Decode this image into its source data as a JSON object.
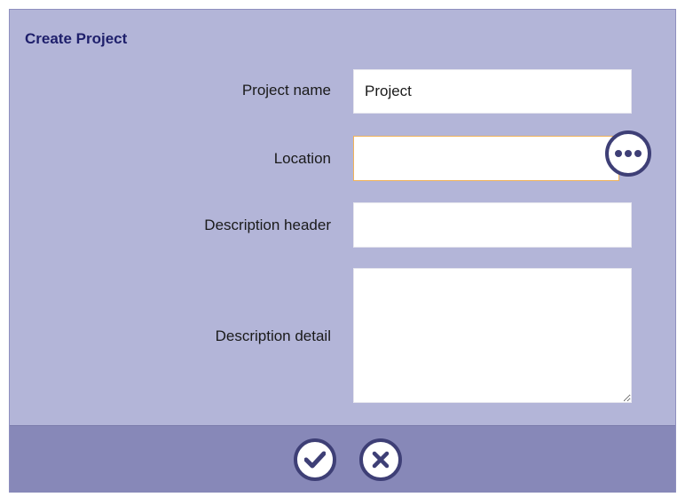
{
  "dialog": {
    "title": "Create Project"
  },
  "fields": {
    "project_name": {
      "label": "Project name",
      "value": "Project",
      "placeholder": ""
    },
    "location": {
      "label": "Location",
      "value": "",
      "placeholder": ""
    },
    "description_header": {
      "label": "Description header",
      "value": "",
      "placeholder": ""
    },
    "description_detail": {
      "label": "Description detail",
      "value": "",
      "placeholder": ""
    }
  },
  "icons": {
    "browse": "ellipsis-icon",
    "confirm": "checkmark-icon",
    "cancel": "close-icon"
  },
  "colors": {
    "dialog_background": "#b3b5d8",
    "footer_background": "#8788b8",
    "title_text": "#1e1f6b",
    "button_border": "#3e3f76",
    "focus_border": "#f0b25a"
  }
}
